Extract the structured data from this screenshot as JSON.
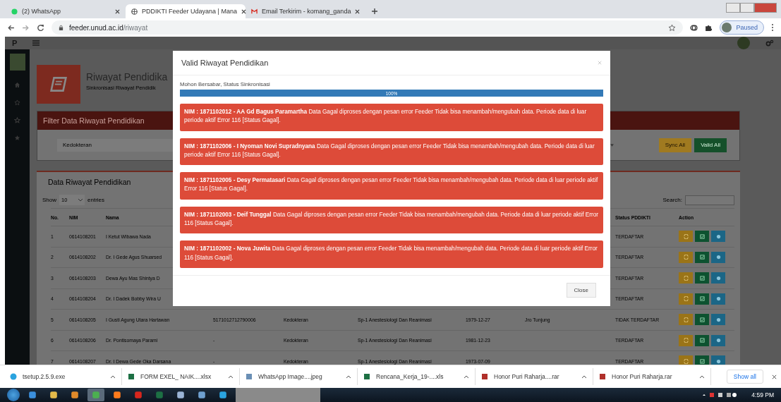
{
  "browser": {
    "tabs": [
      {
        "title": "(2) WhatsApp",
        "kind": "chat",
        "selected": false
      },
      {
        "title": "PDDIKTI Feeder Udayana | Mana",
        "kind": "globe",
        "selected": true
      },
      {
        "title": "Email Terkirim - komang_ganda",
        "kind": "mail",
        "selected": false
      }
    ],
    "address": {
      "host": "feeder.unud.ac.id",
      "path": "/riwayat"
    },
    "profile": "Paused"
  },
  "app": {
    "logo": "P",
    "page_title": "Riwayat Pendidika",
    "page_subtitle": "Sinkronisasi Riwayat Pendidik",
    "filter": {
      "title": "Filter Data Riwayat Pendidikan",
      "faculty": "Kedokteran",
      "buttons": [
        {
          "label": "Sync All",
          "kind": "sync"
        },
        {
          "label": "Valid All",
          "kind": "valid"
        }
      ]
    },
    "data": {
      "title": "Data Riwayat Pendidikan",
      "show_label": "Show",
      "page_size": "10",
      "entries_label": "entries",
      "search_label": "Search:",
      "columns": {
        "no": "No.",
        "nim": "NIM",
        "nama": "Nama",
        "status": "Status PDDIKTI",
        "action": "Action"
      },
      "rows": [
        {
          "no": "1",
          "nim": "0614108201",
          "nama": "I Ketut Wibawa Nada",
          "status": "TERDAFTAR"
        },
        {
          "no": "2",
          "nim": "0614108202",
          "nama": "Dr. I Gede Agus Shuarsed",
          "status": "TERDAFTAR"
        },
        {
          "no": "3",
          "nim": "0614108203",
          "nama": "Dewa Ayu Mas Shintya D",
          "status": "TERDAFTAR"
        },
        {
          "no": "4",
          "nim": "0614108204",
          "nama": "Dr. I Dadek Bobby Wira U",
          "status": "TERDAFTAR"
        },
        {
          "no": "5",
          "nim": "0614108205",
          "nama": "I Gusti Agung Utara Hartawan",
          "column_4": "5171012712790006",
          "fakultas": "Kedokteran",
          "prodi": "Sp-1 Anestesiologi Dan Reanimasi",
          "tanggal": "1979-12-27",
          "column_8": "Jro Tunjung",
          "status": "TIDAK TERDAFTAR"
        },
        {
          "no": "6",
          "nim": "0614108206",
          "nama": "Dr. Pontisomaya Parami",
          "column_4": "-",
          "fakultas": "Kedokteran",
          "prodi": "Sp-1 Anestesiologi Dan Reanimasi",
          "tanggal": "1981-12-23",
          "status": "TERDAFTAR"
        },
        {
          "no": "7",
          "nim": "0614108207",
          "nama": "Dr. I Dewa Gede Oka Darsana",
          "column_4": "-",
          "fakultas": "Kedokteran",
          "prodi": "Sp-1 Anestesiologi Dan Reanimasi",
          "tanggal": "1973-07-09",
          "status": "TERDAFTAR"
        }
      ]
    }
  },
  "modal": {
    "title": "Valid Riwayat Pendidikan",
    "status": "Mohon Bersabar, Status Sinkronisasi",
    "progress": {
      "level": 1,
      "label": "100%"
    },
    "alerts": [
      "**NIM : 1871102012 - AA Gd Bagus Paramartha** Data Gagal diproses dengan pesan error Feeder Tidak bisa menambah/mengubah data. Periode data di luar periode aktif Error 116 [Status Gagal].",
      "**NIM : 1871102006 - I Nyoman Novi Supradnyana** Data Gagal diproses dengan pesan error Feeder Tidak bisa menambah/mengubah data. Periode data di luar periode aktif Error 116 [Status Gagal].",
      "**NIM : 1871102005 - Desy Permatasari** Data Gagal diproses dengan pesan error Feeder Tidak bisa menambah/mengubah data. Periode data di luar periode aktif Error 116 [Status Gagal].",
      "**NIM : 1871102003 - Deif Tunggal** Data Gagal diproses dengan pesan error Feeder Tidak bisa menambah/mengubah data. Periode data di luar periode aktif Error 116 [Status Gagal].",
      "**NIM : 1871102002 - Nova Juwita** Data Gagal diproses dengan pesan error Feeder Tidak bisa menambah/mengubah data. Periode data di luar periode aktif Error 116 [Status Gagal]."
    ],
    "close": "Close"
  },
  "downloads": {
    "items": [
      {
        "name": "tsetup.2.5.9.exe",
        "kind": "app"
      },
      {
        "name": "FORM EXEL_ NAIK....xlsx",
        "kind": "sheet"
      },
      {
        "name": "WhatsApp Image....jpeg",
        "kind": "image"
      },
      {
        "name": "Rencana_Kerja_19-....xls",
        "kind": "sheet"
      },
      {
        "name": "Honor Puri Raharja....rar",
        "kind": "archive"
      },
      {
        "name": "Honor Puri Raharja.rar",
        "kind": "archive"
      }
    ],
    "show_all": "Show all"
  },
  "taskbar": {
    "apps": [
      {
        "kind": "ie",
        "selected": false
      },
      {
        "kind": "folder",
        "selected": false
      },
      {
        "kind": "media",
        "selected": false
      },
      {
        "kind": "chrome",
        "selected": true
      },
      {
        "kind": "firefox",
        "selected": false
      },
      {
        "kind": "pdf",
        "selected": false
      },
      {
        "kind": "excel",
        "selected": false
      },
      {
        "kind": "doc",
        "selected": false
      },
      {
        "kind": "window",
        "selected": false
      },
      {
        "kind": "telegram",
        "selected": false
      }
    ],
    "time": "4:59 PM"
  }
}
